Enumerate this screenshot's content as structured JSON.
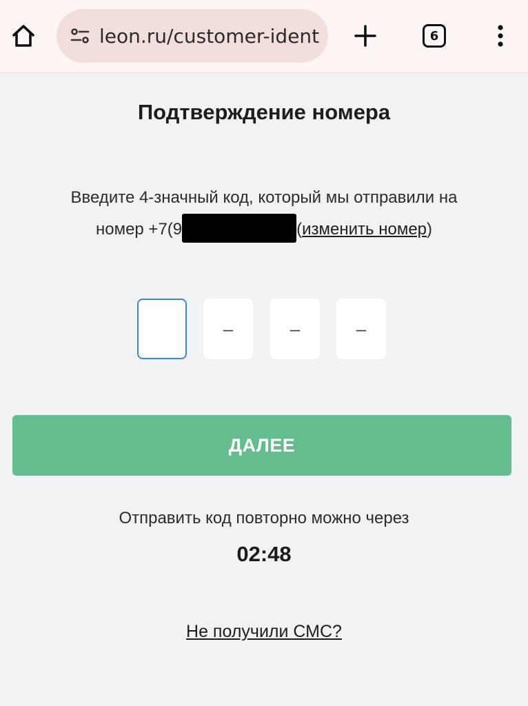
{
  "browser": {
    "url": "leon.ru/customer-identification",
    "tab_count": "6",
    "icons": [
      "home-icon",
      "site-settings-icon",
      "plus-icon",
      "tabs-icon",
      "more-vert-icon"
    ]
  },
  "page": {
    "title": "Подтверждение номера",
    "instruction_line1": "Введите 4-значный код, который мы отправили на",
    "phone_prefix": "номер +7(9",
    "change_number_link": "изменить номер",
    "paren_open": "(",
    "paren_close": ")",
    "code_placeholders": [
      "",
      "–",
      "–",
      "–"
    ],
    "next_button": "ДАЛЕЕ",
    "resend_text": "Отправить код повторно можно через",
    "timer": "02:48",
    "no_sms_link": "Не получили СМС?"
  },
  "colors": {
    "accent_green": "#63bd8e",
    "focus_blue": "#3d86d6",
    "background": "#f1f2f4",
    "browser_bar": "#fdf6f4",
    "url_pill": "#f2dfdb"
  }
}
